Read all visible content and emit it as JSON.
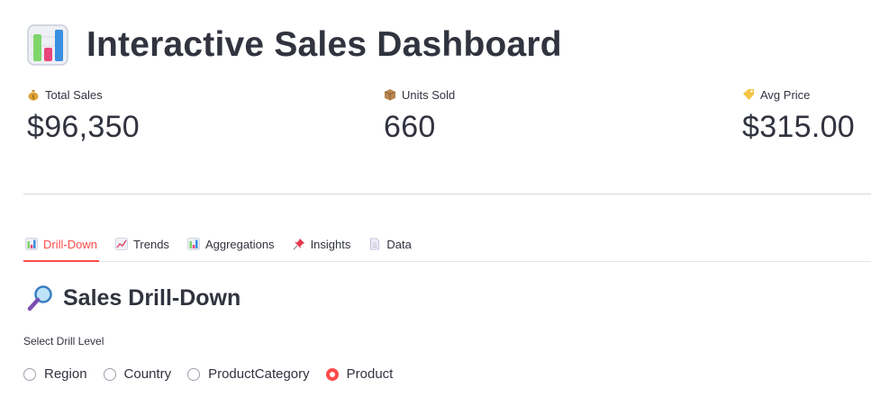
{
  "header": {
    "title": "Interactive Sales Dashboard",
    "title_icon": "bar-chart-icon"
  },
  "metrics": [
    {
      "label": "Total Sales",
      "value": "$96,350",
      "icon": "money-bag-icon"
    },
    {
      "label": "Units Sold",
      "value": "660",
      "icon": "package-icon"
    },
    {
      "label": "Avg Price",
      "value": "$315.00",
      "icon": "price-tag-icon"
    }
  ],
  "tabs": [
    {
      "label": "Drill-Down",
      "icon": "bar-chart-icon",
      "active": true
    },
    {
      "label": "Trends",
      "icon": "chart-increasing-icon",
      "active": false
    },
    {
      "label": "Aggregations",
      "icon": "bar-chart-icon",
      "active": false
    },
    {
      "label": "Insights",
      "icon": "pushpin-icon",
      "active": false
    },
    {
      "label": "Data",
      "icon": "page-icon",
      "active": false
    }
  ],
  "section": {
    "title": "Sales Drill-Down",
    "icon": "magnifying-glass-icon"
  },
  "drill": {
    "label": "Select Drill Level",
    "options": [
      "Region",
      "Country",
      "ProductCategory",
      "Product"
    ],
    "selected": "Product"
  },
  "colors": {
    "accent": "#ff4b4b",
    "text": "#31333f",
    "divider": "#d6d6d9"
  }
}
